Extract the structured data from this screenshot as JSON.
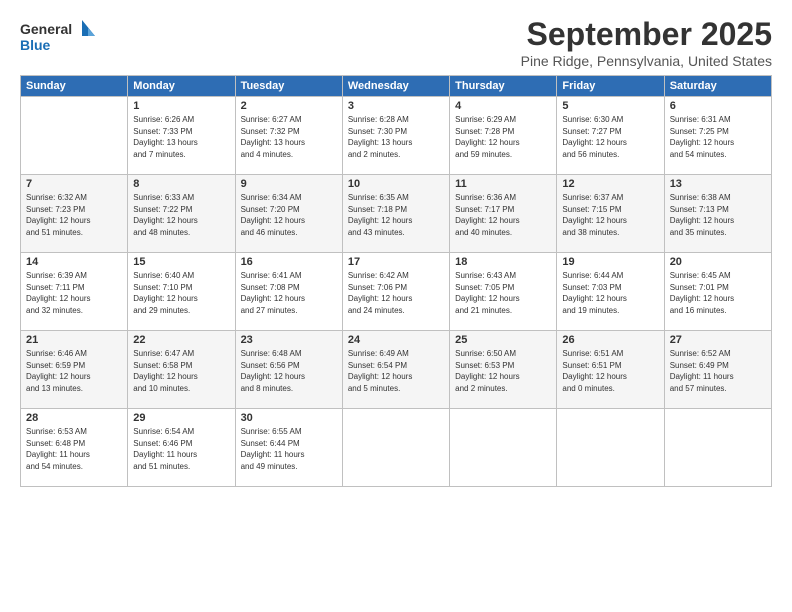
{
  "logo": {
    "line1": "General",
    "line2": "Blue"
  },
  "title": "September 2025",
  "subtitle": "Pine Ridge, Pennsylvania, United States",
  "days_of_week": [
    "Sunday",
    "Monday",
    "Tuesday",
    "Wednesday",
    "Thursday",
    "Friday",
    "Saturday"
  ],
  "weeks": [
    [
      {
        "day": "",
        "info": ""
      },
      {
        "day": "1",
        "info": "Sunrise: 6:26 AM\nSunset: 7:33 PM\nDaylight: 13 hours\nand 7 minutes."
      },
      {
        "day": "2",
        "info": "Sunrise: 6:27 AM\nSunset: 7:32 PM\nDaylight: 13 hours\nand 4 minutes."
      },
      {
        "day": "3",
        "info": "Sunrise: 6:28 AM\nSunset: 7:30 PM\nDaylight: 13 hours\nand 2 minutes."
      },
      {
        "day": "4",
        "info": "Sunrise: 6:29 AM\nSunset: 7:28 PM\nDaylight: 12 hours\nand 59 minutes."
      },
      {
        "day": "5",
        "info": "Sunrise: 6:30 AM\nSunset: 7:27 PM\nDaylight: 12 hours\nand 56 minutes."
      },
      {
        "day": "6",
        "info": "Sunrise: 6:31 AM\nSunset: 7:25 PM\nDaylight: 12 hours\nand 54 minutes."
      }
    ],
    [
      {
        "day": "7",
        "info": "Sunrise: 6:32 AM\nSunset: 7:23 PM\nDaylight: 12 hours\nand 51 minutes."
      },
      {
        "day": "8",
        "info": "Sunrise: 6:33 AM\nSunset: 7:22 PM\nDaylight: 12 hours\nand 48 minutes."
      },
      {
        "day": "9",
        "info": "Sunrise: 6:34 AM\nSunset: 7:20 PM\nDaylight: 12 hours\nand 46 minutes."
      },
      {
        "day": "10",
        "info": "Sunrise: 6:35 AM\nSunset: 7:18 PM\nDaylight: 12 hours\nand 43 minutes."
      },
      {
        "day": "11",
        "info": "Sunrise: 6:36 AM\nSunset: 7:17 PM\nDaylight: 12 hours\nand 40 minutes."
      },
      {
        "day": "12",
        "info": "Sunrise: 6:37 AM\nSunset: 7:15 PM\nDaylight: 12 hours\nand 38 minutes."
      },
      {
        "day": "13",
        "info": "Sunrise: 6:38 AM\nSunset: 7:13 PM\nDaylight: 12 hours\nand 35 minutes."
      }
    ],
    [
      {
        "day": "14",
        "info": "Sunrise: 6:39 AM\nSunset: 7:11 PM\nDaylight: 12 hours\nand 32 minutes."
      },
      {
        "day": "15",
        "info": "Sunrise: 6:40 AM\nSunset: 7:10 PM\nDaylight: 12 hours\nand 29 minutes."
      },
      {
        "day": "16",
        "info": "Sunrise: 6:41 AM\nSunset: 7:08 PM\nDaylight: 12 hours\nand 27 minutes."
      },
      {
        "day": "17",
        "info": "Sunrise: 6:42 AM\nSunset: 7:06 PM\nDaylight: 12 hours\nand 24 minutes."
      },
      {
        "day": "18",
        "info": "Sunrise: 6:43 AM\nSunset: 7:05 PM\nDaylight: 12 hours\nand 21 minutes."
      },
      {
        "day": "19",
        "info": "Sunrise: 6:44 AM\nSunset: 7:03 PM\nDaylight: 12 hours\nand 19 minutes."
      },
      {
        "day": "20",
        "info": "Sunrise: 6:45 AM\nSunset: 7:01 PM\nDaylight: 12 hours\nand 16 minutes."
      }
    ],
    [
      {
        "day": "21",
        "info": "Sunrise: 6:46 AM\nSunset: 6:59 PM\nDaylight: 12 hours\nand 13 minutes."
      },
      {
        "day": "22",
        "info": "Sunrise: 6:47 AM\nSunset: 6:58 PM\nDaylight: 12 hours\nand 10 minutes."
      },
      {
        "day": "23",
        "info": "Sunrise: 6:48 AM\nSunset: 6:56 PM\nDaylight: 12 hours\nand 8 minutes."
      },
      {
        "day": "24",
        "info": "Sunrise: 6:49 AM\nSunset: 6:54 PM\nDaylight: 12 hours\nand 5 minutes."
      },
      {
        "day": "25",
        "info": "Sunrise: 6:50 AM\nSunset: 6:53 PM\nDaylight: 12 hours\nand 2 minutes."
      },
      {
        "day": "26",
        "info": "Sunrise: 6:51 AM\nSunset: 6:51 PM\nDaylight: 12 hours\nand 0 minutes."
      },
      {
        "day": "27",
        "info": "Sunrise: 6:52 AM\nSunset: 6:49 PM\nDaylight: 11 hours\nand 57 minutes."
      }
    ],
    [
      {
        "day": "28",
        "info": "Sunrise: 6:53 AM\nSunset: 6:48 PM\nDaylight: 11 hours\nand 54 minutes."
      },
      {
        "day": "29",
        "info": "Sunrise: 6:54 AM\nSunset: 6:46 PM\nDaylight: 11 hours\nand 51 minutes."
      },
      {
        "day": "30",
        "info": "Sunrise: 6:55 AM\nSunset: 6:44 PM\nDaylight: 11 hours\nand 49 minutes."
      },
      {
        "day": "",
        "info": ""
      },
      {
        "day": "",
        "info": ""
      },
      {
        "day": "",
        "info": ""
      },
      {
        "day": "",
        "info": ""
      }
    ]
  ]
}
